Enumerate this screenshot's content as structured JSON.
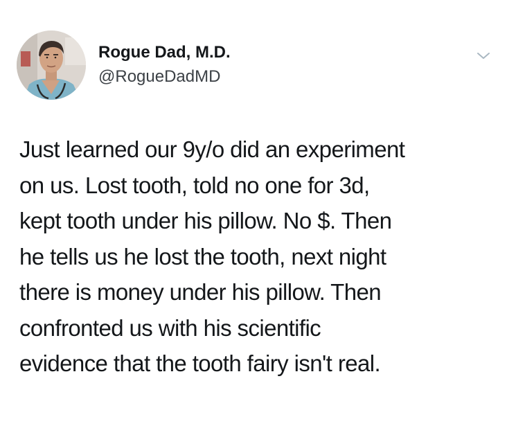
{
  "tweet": {
    "author": {
      "display_name": "Rogue Dad, M.D.",
      "handle": "@RogueDadMD",
      "avatar_icon": "profile-photo-man-in-scrubs"
    },
    "menu_icon": "chevron-down-icon",
    "text_lines": [
      "Just learned our 9y/o did an experiment",
      "on us.  Lost tooth, told no one for 3d,",
      "kept tooth under his pillow.  No $.  Then",
      "he tells us he lost the tooth, next night",
      "there is money under his pillow.  Then",
      "confronted us with his scientific",
      "evidence that the tooth fairy isn't real."
    ]
  },
  "colors": {
    "background": "#ffffff",
    "text": "#14171a",
    "secondary_text": "#3c4146",
    "caret": "#aab8c2"
  }
}
